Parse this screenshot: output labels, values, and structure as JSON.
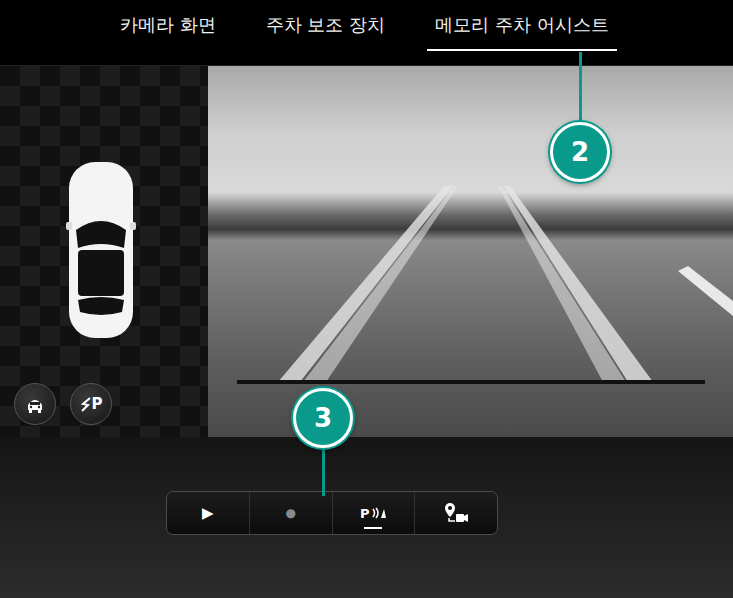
{
  "tabs": [
    {
      "label": "카메라 화면",
      "selected": false
    },
    {
      "label": "주차 보조 장치",
      "selected": false
    },
    {
      "label": "메모리 주차 어시스트",
      "selected": true
    }
  ],
  "callouts": [
    {
      "label": "2",
      "target": "tab"
    },
    {
      "label": "3",
      "target": "toolbar"
    }
  ],
  "side_buttons": [
    {
      "kind": "car-view"
    },
    {
      "kind": "park",
      "label": "P"
    }
  ],
  "toolbar": {
    "buttons": [
      {
        "kind": "play",
        "label": "▶",
        "selected": false
      },
      {
        "kind": "record",
        "label": "●",
        "selected": false
      },
      {
        "kind": "sensor",
        "label": "P",
        "selected": true
      },
      {
        "kind": "location",
        "selected": false
      }
    ]
  }
}
